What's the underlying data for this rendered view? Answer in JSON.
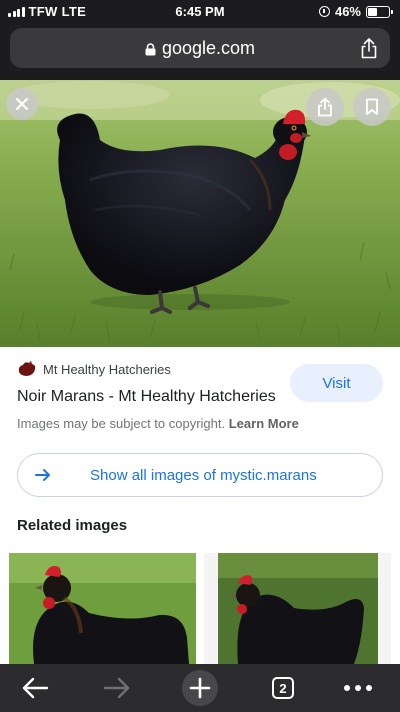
{
  "status_bar": {
    "carrier": "TFW",
    "network": "LTE",
    "time": "6:45 PM",
    "battery": "46%",
    "battery_level": 0.46
  },
  "browser": {
    "url": "google.com",
    "tab_count": "2"
  },
  "image_viewer": {
    "source": "Mt Healthy Hatcheries",
    "title": "Noir Marans - Mt Healthy Hatcheries",
    "visit_label": "Visit",
    "copyright": "Images may be subject to copyright.",
    "learn_more": "Learn More",
    "show_all_label": "Show all images of mystic.marans",
    "related_heading": "Related images"
  },
  "colors": {
    "accent": "#1a73e8",
    "visit_bg": "#e8f0fe",
    "chrome_dark": "#1c1c1e"
  },
  "icons": {
    "close": "close-icon",
    "share": "share-icon",
    "bookmark": "bookmark-icon",
    "back": "back-arrow-icon",
    "forward": "forward-arrow-icon",
    "new_tab": "plus-icon",
    "menu": "more-dots-icon"
  }
}
